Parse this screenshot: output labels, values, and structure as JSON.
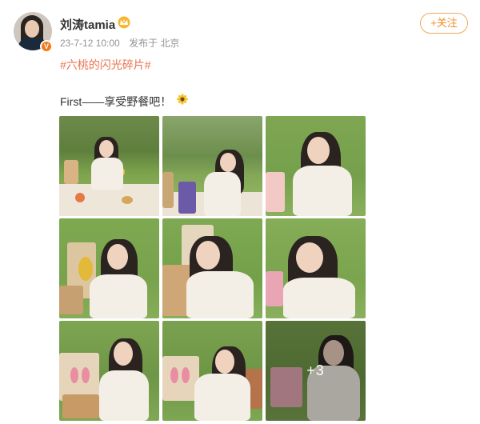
{
  "author": {
    "name": "刘涛tamia",
    "avatar_icon": "avatar-photo",
    "verified_icon": "verified-v-badge",
    "badge_icon": "crown-badge-icon",
    "verified_letter": "V"
  },
  "post_meta": {
    "date": "23-7-12 10:00",
    "source": "发布于 北京"
  },
  "follow_button": {
    "label": "+关注"
  },
  "post": {
    "topic": "#六桃的闪光碎片#",
    "text": "First——享受野餐吧！",
    "emoji_icon": "sunflower-emoji-icon"
  },
  "gallery": {
    "photo_count_visible": 9,
    "more_label": "+3"
  }
}
